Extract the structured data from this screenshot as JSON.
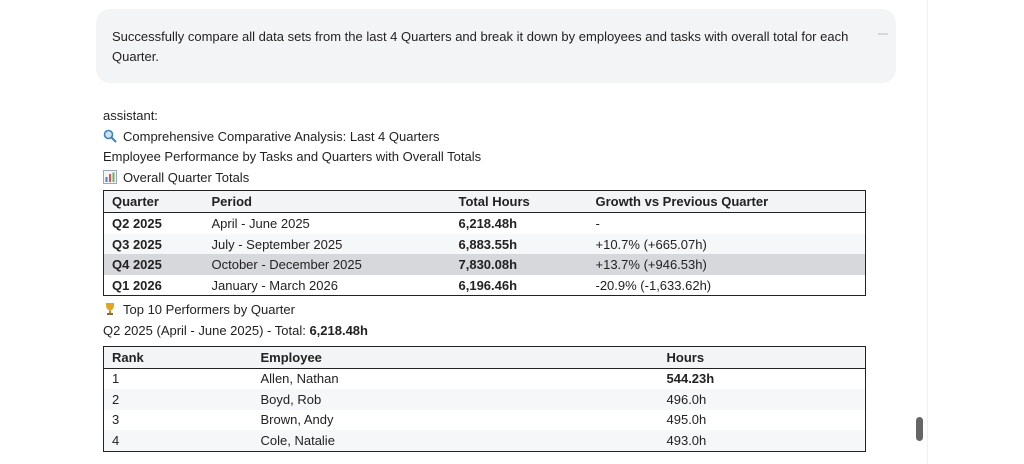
{
  "user_message": "Successfully compare all data sets from the last 4 Quarters and break it down by employees and tasks with overall total for each Quarter.",
  "assistant": {
    "role_label": "assistant:",
    "heading": "Comprehensive Comparative Analysis: Last 4 Quarters",
    "subheading": "Employee Performance by Tasks and Quarters with Overall Totals",
    "totals_heading": "Overall Quarter Totals",
    "totals_table": {
      "headers": [
        "Quarter",
        "Period",
        "Total Hours",
        "Growth vs Previous Quarter"
      ],
      "rows": [
        [
          "Q2 2025",
          "April - June 2025",
          "6,218.48h",
          "-"
        ],
        [
          "Q3 2025",
          "July - September 2025",
          "6,883.55h",
          "+10.7% (+665.07h)"
        ],
        [
          "Q4 2025",
          "October - December 2025",
          "7,830.08h",
          "+13.7% (+946.53h)"
        ],
        [
          "Q1 2026",
          "January - March 2026",
          "6,196.46h",
          "-20.9% (-1,633.62h)"
        ]
      ]
    },
    "performers_heading": "Top 10 Performers by Quarter",
    "q2_caption_prefix": "Q2 2025 (April - June 2025) - Total: ",
    "q2_caption_total": "6,218.48h",
    "performers_table": {
      "headers": [
        "Rank",
        "Employee",
        "Hours"
      ],
      "rows": [
        [
          "1",
          "Allen, Nathan",
          "544.23h"
        ],
        [
          "2",
          "Boyd, Rob",
          "496.0h"
        ],
        [
          "3",
          "Brown, Andy",
          "495.0h"
        ],
        [
          "4",
          "Cole, Natalie",
          "493.0h"
        ]
      ]
    }
  },
  "colors": {
    "accent_search": "#3b82c4",
    "chart_icon": "#4a7fc1"
  },
  "icons": {
    "heading": "magnifier-icon",
    "totals": "bar-chart-icon",
    "performers": "trophy-icon"
  }
}
